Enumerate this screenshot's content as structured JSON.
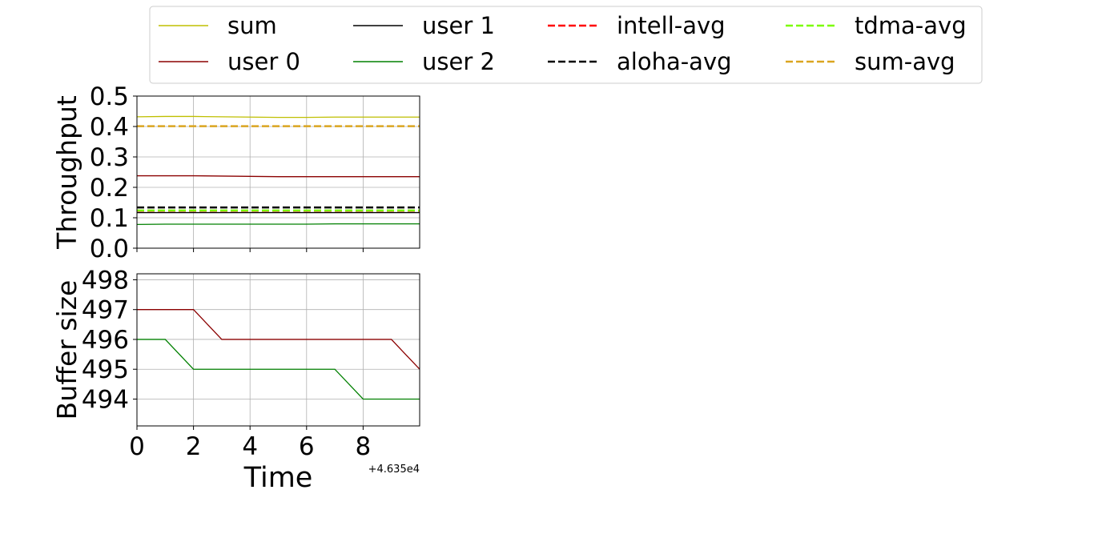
{
  "legend": {
    "entries": [
      {
        "label": "sum",
        "color": "#bfbf00",
        "style": "solid"
      },
      {
        "label": "user 0",
        "color": "#8b0000",
        "style": "solid"
      },
      {
        "label": "user 1",
        "color": "#000000",
        "style": "solid"
      },
      {
        "label": "user 2",
        "color": "#008000",
        "style": "solid"
      },
      {
        "label": "intell-avg",
        "color": "#ff0000",
        "style": "dashed"
      },
      {
        "label": "aloha-avg",
        "color": "#000000",
        "style": "dashed"
      },
      {
        "label": "tdma-avg",
        "color": "#7cfc00",
        "style": "dashed"
      },
      {
        "label": "sum-avg",
        "color": "#daa520",
        "style": "dashed"
      }
    ]
  },
  "chart_data": [
    {
      "type": "line",
      "ylabel": "Throughput",
      "xlim": [
        0,
        10
      ],
      "ylim": [
        0,
        0.5
      ],
      "yticks": [
        "0.0",
        "0.1",
        "0.2",
        "0.3",
        "0.4",
        "0.5"
      ],
      "xticks": [
        0,
        2,
        4,
        6,
        8
      ],
      "grid": true,
      "x": [
        0,
        1,
        2,
        3,
        4,
        5,
        6,
        7,
        8,
        9,
        10
      ],
      "series": [
        {
          "name": "sum",
          "color": "#bfbf00",
          "style": "solid",
          "values": [
            0.432,
            0.433,
            0.433,
            0.432,
            0.431,
            0.43,
            0.43,
            0.431,
            0.431,
            0.431,
            0.431
          ]
        },
        {
          "name": "user 0",
          "color": "#8b0000",
          "style": "solid",
          "values": [
            0.238,
            0.238,
            0.238,
            0.237,
            0.236,
            0.235,
            0.235,
            0.235,
            0.235,
            0.235,
            0.235
          ]
        },
        {
          "name": "user 1",
          "color": "#000000",
          "style": "solid",
          "values": [
            0.117,
            0.117,
            0.117,
            0.117,
            0.117,
            0.117,
            0.117,
            0.117,
            0.117,
            0.117,
            0.117
          ]
        },
        {
          "name": "user 2",
          "color": "#008000",
          "style": "solid",
          "values": [
            0.078,
            0.079,
            0.079,
            0.079,
            0.079,
            0.079,
            0.079,
            0.08,
            0.08,
            0.08,
            0.08
          ]
        }
      ],
      "hlines": [
        {
          "name": "intell-avg",
          "color": "#ff0000",
          "style": "dashed",
          "value": 0.123
        },
        {
          "name": "aloha-avg",
          "color": "#000000",
          "style": "dashed",
          "value": 0.134
        },
        {
          "name": "tdma-avg",
          "color": "#7cfc00",
          "style": "dashed",
          "value": 0.124
        },
        {
          "name": "sum-avg",
          "color": "#daa520",
          "style": "dashed",
          "value": 0.401
        }
      ]
    },
    {
      "type": "line",
      "xlabel": "Time",
      "ylabel": "Buffer size",
      "x_offset_label": "+4.635e4",
      "xlim": [
        0,
        10
      ],
      "ylim": [
        493.1,
        498.2
      ],
      "yticks": [
        "494",
        "495",
        "496",
        "497",
        "498"
      ],
      "xticks": [
        "0",
        "2",
        "4",
        "6",
        "8"
      ],
      "grid": true,
      "x": [
        0,
        1,
        2,
        3,
        4,
        5,
        6,
        7,
        8,
        9,
        10
      ],
      "series": [
        {
          "name": "user 0",
          "color": "#8b0000",
          "style": "solid",
          "values": [
            497,
            497,
            497,
            496,
            496,
            496,
            496,
            496,
            496,
            496,
            495
          ]
        },
        {
          "name": "user 2",
          "color": "#008000",
          "style": "solid",
          "values": [
            496,
            496,
            495,
            495,
            495,
            495,
            495,
            495,
            494,
            494,
            494
          ]
        }
      ]
    }
  ]
}
